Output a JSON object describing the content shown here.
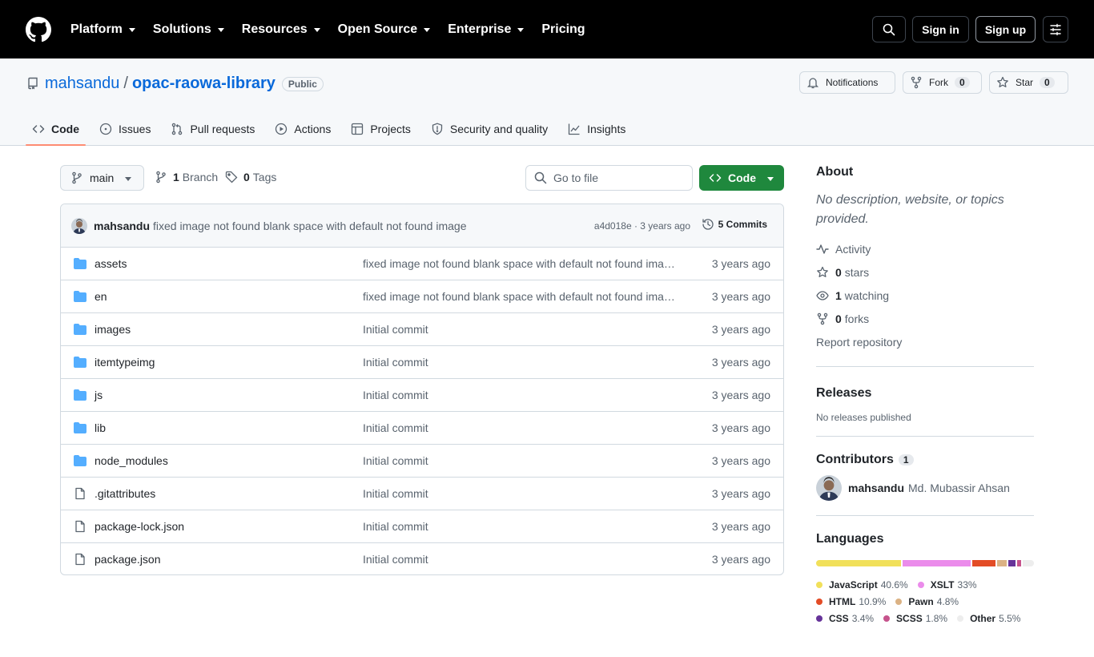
{
  "header": {
    "nav": [
      "Platform",
      "Solutions",
      "Resources",
      "Open Source",
      "Enterprise",
      "Pricing"
    ],
    "sign_in": "Sign in",
    "sign_up": "Sign up",
    "icons": [
      "github-logo-icon",
      "search-icon",
      "sliders-menu-icon"
    ]
  },
  "repo": {
    "owner": "mahsandu",
    "separator": "/",
    "name": "opac-raowa-library",
    "visibility": "Public",
    "notifications_label": "Notifications",
    "fork_label": "Fork",
    "fork_count": "0",
    "star_label": "Star",
    "star_count": "0"
  },
  "tabs": [
    {
      "label": "Code",
      "icon": "code-icon",
      "active": true
    },
    {
      "label": "Issues",
      "icon": "issue-icon"
    },
    {
      "label": "Pull requests",
      "icon": "pull-request-icon"
    },
    {
      "label": "Actions",
      "icon": "play-icon"
    },
    {
      "label": "Projects",
      "icon": "table-icon"
    },
    {
      "label": "Security and quality",
      "icon": "shield-icon"
    },
    {
      "label": "Insights",
      "icon": "graph-icon"
    }
  ],
  "toolbar": {
    "branch": "main",
    "branch_count": "1",
    "branch_label": "Branch",
    "tag_count": "0",
    "tag_label": "Tags",
    "goto_placeholder": "Go to file",
    "code_label": "Code"
  },
  "commit": {
    "author": "mahsandu",
    "message": "fixed image not found blank space with default not found image",
    "sha_time": "a4d018e · 3 years ago",
    "commits_label": "5 Commits"
  },
  "files": [
    {
      "type": "dir",
      "name": "assets",
      "message": "fixed image not found blank space with default not found image",
      "time": "3 years ago"
    },
    {
      "type": "dir",
      "name": "en",
      "message": "fixed image not found blank space with default not found image",
      "time": "3 years ago"
    },
    {
      "type": "dir",
      "name": "images",
      "message": "Initial commit",
      "time": "3 years ago"
    },
    {
      "type": "dir",
      "name": "itemtypeimg",
      "message": "Initial commit",
      "time": "3 years ago"
    },
    {
      "type": "dir",
      "name": "js",
      "message": "Initial commit",
      "time": "3 years ago"
    },
    {
      "type": "dir",
      "name": "lib",
      "message": "Initial commit",
      "time": "3 years ago"
    },
    {
      "type": "dir",
      "name": "node_modules",
      "message": "Initial commit",
      "time": "3 years ago"
    },
    {
      "type": "file",
      "name": ".gitattributes",
      "message": "Initial commit",
      "time": "3 years ago"
    },
    {
      "type": "file",
      "name": "package-lock.json",
      "message": "Initial commit",
      "time": "3 years ago"
    },
    {
      "type": "file",
      "name": "package.json",
      "message": "Initial commit",
      "time": "3 years ago"
    }
  ],
  "about": {
    "title": "About",
    "description": "No description, website, or topics provided.",
    "activity": "Activity",
    "stars_count": "0",
    "stars_label": "stars",
    "watching_count": "1",
    "watching_label": "watching",
    "forks_count": "0",
    "forks_label": "forks",
    "report": "Report repository"
  },
  "releases": {
    "title": "Releases",
    "empty": "No releases published"
  },
  "contributors": {
    "title": "Contributors",
    "count": "1",
    "login": "mahsandu",
    "full_name": "Md. Mubassir Ahsan"
  },
  "languages": {
    "title": "Languages",
    "items": [
      {
        "name": "JavaScript",
        "percent": "40.6%",
        "value": 40.6,
        "color": "#f1e05a"
      },
      {
        "name": "XSLT",
        "percent": "33%",
        "value": 33.0,
        "color": "#eb8ceb"
      },
      {
        "name": "HTML",
        "percent": "10.9%",
        "value": 10.9,
        "color": "#e34c26"
      },
      {
        "name": "Pawn",
        "percent": "4.8%",
        "value": 4.8,
        "color": "#dbb284"
      },
      {
        "name": "CSS",
        "percent": "3.4%",
        "value": 3.4,
        "color": "#663399"
      },
      {
        "name": "SCSS",
        "percent": "1.8%",
        "value": 1.8,
        "color": "#c6538c"
      },
      {
        "name": "Other",
        "percent": "5.5%",
        "value": 5.5,
        "color": "#ededed"
      }
    ]
  },
  "colors": {
    "header_bg": "#000000",
    "link": "#0969da",
    "primary_button": "#1f883d",
    "tab_underline": "#fd8c73",
    "folder": "#54aeff"
  }
}
